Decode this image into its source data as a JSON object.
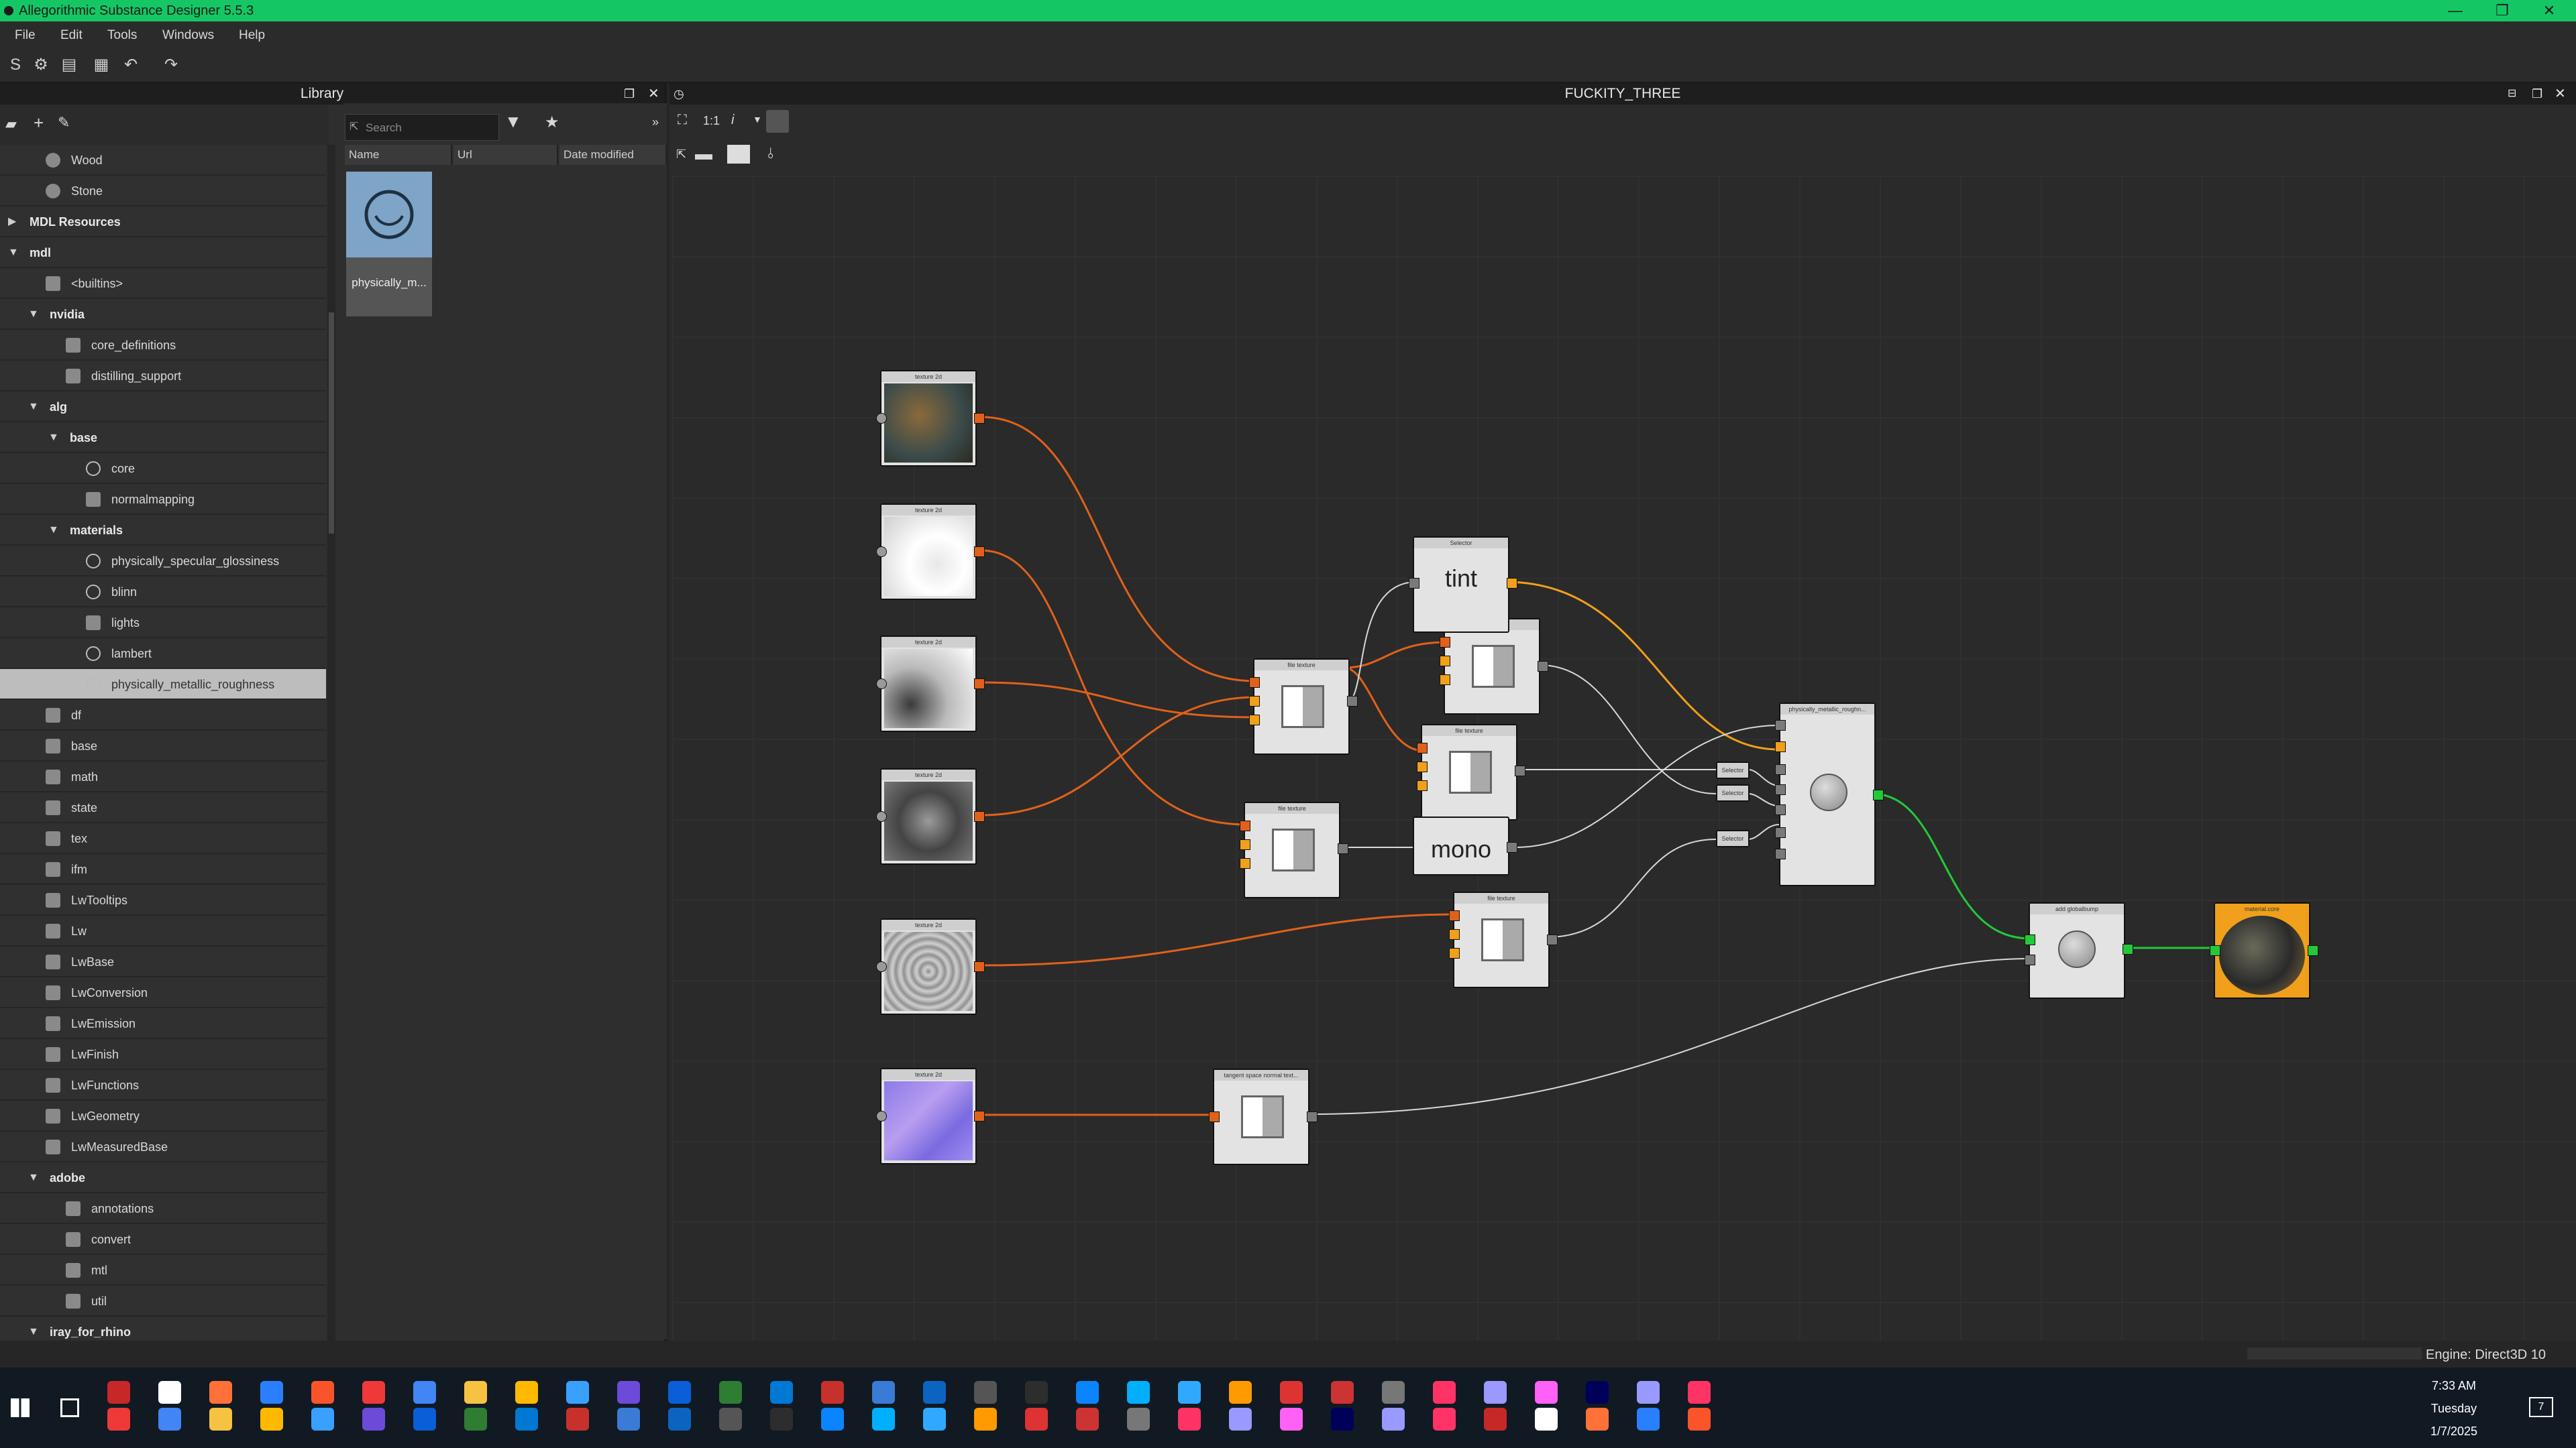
{
  "window": {
    "title": "Allegorithmic Substance Designer 5.5.3"
  },
  "menu": {
    "items": [
      "File",
      "Edit",
      "Tools",
      "Windows",
      "Help"
    ]
  },
  "library": {
    "title": "Library",
    "search_placeholder": "Search",
    "columns": [
      "Name",
      "Url",
      "Date modified"
    ],
    "selected_item_label": "physically_m...",
    "tree": [
      {
        "label": "Wood",
        "level": 1,
        "kind": "sphere"
      },
      {
        "label": "Stone",
        "level": 1,
        "kind": "sphere"
      },
      {
        "label": "MDL Resources",
        "level": 0,
        "kind": "folder-collapsed",
        "bold": true
      },
      {
        "label": "mdl",
        "level": 0,
        "kind": "folder-open",
        "bold": true
      },
      {
        "label": "<builtins>",
        "level": 1,
        "kind": "pkg"
      },
      {
        "label": "nvidia",
        "level": 1,
        "kind": "folder-open",
        "bold": true
      },
      {
        "label": "core_definitions",
        "level": 2,
        "kind": "pkg"
      },
      {
        "label": "distilling_support",
        "level": 2,
        "kind": "pkg"
      },
      {
        "label": "alg",
        "level": 1,
        "kind": "folder-open",
        "bold": true
      },
      {
        "label": "base",
        "level": 2,
        "kind": "folder-open",
        "bold": true
      },
      {
        "label": "core",
        "level": 3,
        "kind": "circle"
      },
      {
        "label": "normalmapping",
        "level": 3,
        "kind": "pkg"
      },
      {
        "label": "materials",
        "level": 2,
        "kind": "folder-open",
        "bold": true
      },
      {
        "label": "physically_specular_glossiness",
        "level": 3,
        "kind": "circle"
      },
      {
        "label": "blinn",
        "level": 3,
        "kind": "circle"
      },
      {
        "label": "lights",
        "level": 3,
        "kind": "light"
      },
      {
        "label": "lambert",
        "level": 3,
        "kind": "circle"
      },
      {
        "label": "physically_metallic_roughness",
        "level": 3,
        "kind": "circle",
        "selected": true
      },
      {
        "label": "df",
        "level": 1,
        "kind": "graph"
      },
      {
        "label": "base",
        "level": 1,
        "kind": "pkg"
      },
      {
        "label": "math",
        "level": 1,
        "kind": "graph"
      },
      {
        "label": "state",
        "level": 1,
        "kind": "state"
      },
      {
        "label": "tex",
        "level": 1,
        "kind": "tex"
      },
      {
        "label": "ifm",
        "level": 1,
        "kind": "pkg"
      },
      {
        "label": "LwTooltips",
        "level": 1,
        "kind": "pkg"
      },
      {
        "label": "Lw",
        "level": 1,
        "kind": "pkg"
      },
      {
        "label": "LwBase",
        "level": 1,
        "kind": "pkg"
      },
      {
        "label": "LwConversion",
        "level": 1,
        "kind": "pkg"
      },
      {
        "label": "LwEmission",
        "level": 1,
        "kind": "pkg"
      },
      {
        "label": "LwFinish",
        "level": 1,
        "kind": "pkg"
      },
      {
        "label": "LwFunctions",
        "level": 1,
        "kind": "pkg"
      },
      {
        "label": "LwGeometry",
        "level": 1,
        "kind": "pkg"
      },
      {
        "label": "LwMeasuredBase",
        "level": 1,
        "kind": "pkg"
      },
      {
        "label": "adobe",
        "level": 1,
        "kind": "folder-open",
        "bold": true
      },
      {
        "label": "annotations",
        "level": 2,
        "kind": "pkg"
      },
      {
        "label": "convert",
        "level": 2,
        "kind": "pkg"
      },
      {
        "label": "mtl",
        "level": 2,
        "kind": "pkg"
      },
      {
        "label": "util",
        "level": 2,
        "kind": "pkg"
      },
      {
        "label": "iray_for_rhino",
        "level": 1,
        "kind": "folder-open",
        "bold": true
      }
    ]
  },
  "graph": {
    "title": "FUCKITY_THREE",
    "zoom_label": "1:1",
    "nodes": {
      "tex1": "texture 2d",
      "tex2": "texture 2d",
      "tex3": "texture 2d",
      "tex4": "texture 2d",
      "tex5": "texture 2d",
      "tex6": "texture 2d",
      "fileA": "file texture",
      "fileB": "file texture",
      "fileC": "file texture",
      "fileD": "file texture",
      "fileE": "file texture",
      "tint": "tint",
      "tint_title": "Selector",
      "mono": "mono",
      "pmr": "physically_metallic_roughn...",
      "sel1": "Selector",
      "sel2": "Selector",
      "sel3": "Selector",
      "bump": "add globalbump",
      "tangent": "tangent space normal text...",
      "output": "material.core"
    }
  },
  "status": {
    "engine": "Engine: Direct3D 10"
  },
  "taskbar": {
    "time": "7:33 AM",
    "day": "Tuesday",
    "date": "1/7/2025",
    "badge": "7"
  }
}
